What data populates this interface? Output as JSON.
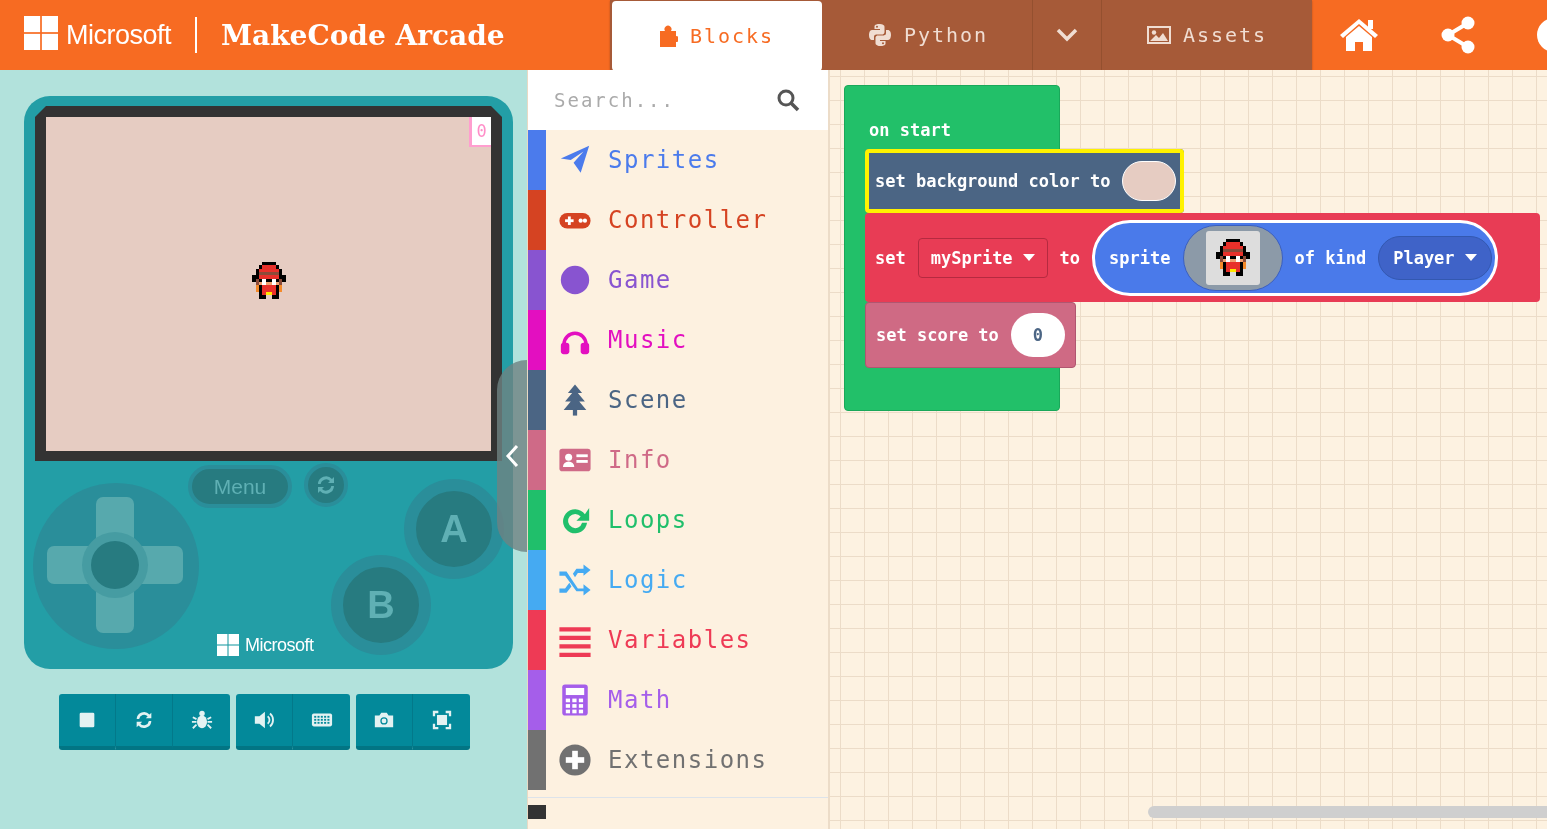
{
  "header": {
    "brand": "Microsoft",
    "title": "MakeCode Arcade",
    "tabs": [
      {
        "label": "Blocks",
        "kind": "puzzle",
        "selected": true
      },
      {
        "label": "Python",
        "kind": "python",
        "selected": false
      },
      {
        "label": "Assets",
        "kind": "image",
        "selected": false
      }
    ]
  },
  "simulator": {
    "score": "0",
    "menu_label": "Menu",
    "a_label": "A",
    "b_label": "B",
    "brand": "Microsoft"
  },
  "toolbox": {
    "search": {
      "placeholder": "Search..."
    },
    "categories": [
      {
        "label": "Sprites",
        "kind": "plane",
        "color": "#4b7bec"
      },
      {
        "label": "Controller",
        "kind": "gamepad",
        "color": "#d54322"
      },
      {
        "label": "Game",
        "kind": "dot",
        "color": "#8854d0"
      },
      {
        "label": "Music",
        "kind": "headphones",
        "color": "#e30fc0"
      },
      {
        "label": "Scene",
        "kind": "tree",
        "color": "#4b6584"
      },
      {
        "label": "Info",
        "kind": "card",
        "color": "#cf6a87"
      },
      {
        "label": "Loops",
        "kind": "loop",
        "color": "#20bf6b"
      },
      {
        "label": "Logic",
        "kind": "shuffle",
        "color": "#45aaf2"
      },
      {
        "label": "Variables",
        "kind": "lines",
        "color": "#ee3a55"
      },
      {
        "label": "Math",
        "kind": "calculator",
        "color": "#a55eea"
      },
      {
        "label": "Extensions",
        "kind": "plus",
        "color": "#717171"
      }
    ]
  },
  "workspace": {
    "event_block": {
      "label": "on start",
      "statements": [
        {
          "kind": "background",
          "text": "set background color to",
          "selected": true
        },
        {
          "kind": "set_sprite",
          "set": "set",
          "variable": "mySprite",
          "to": "to",
          "sprite": "sprite",
          "of_kind": "of kind",
          "sprite_kind": "Player",
          "selected": false
        },
        {
          "kind": "score",
          "text": "set score to",
          "value": "0",
          "selected": false
        }
      ]
    }
  }
}
